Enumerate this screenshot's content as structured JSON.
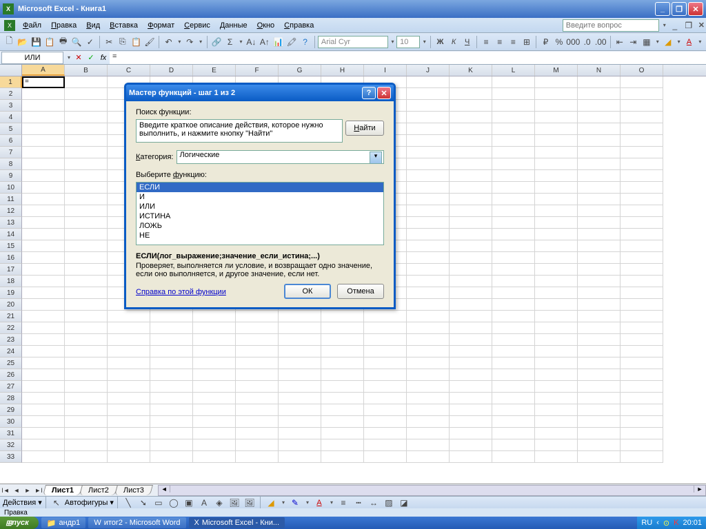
{
  "titlebar": {
    "app": "Microsoft Excel",
    "doc": "Книга1"
  },
  "menu": [
    "Файл",
    "Правка",
    "Вид",
    "Вставка",
    "Формат",
    "Сервис",
    "Данные",
    "Окно",
    "Справка"
  ],
  "questionPlaceholder": "Введите вопрос",
  "formatBar": {
    "font": "Arial Cyr",
    "size": "10"
  },
  "formula": {
    "nameBox": "ИЛИ",
    "value": "="
  },
  "columns": [
    "A",
    "B",
    "C",
    "D",
    "E",
    "F",
    "G",
    "H",
    "I",
    "J",
    "K",
    "L",
    "M",
    "N",
    "O"
  ],
  "rowCount": 33,
  "activeCell": {
    "row": 1,
    "col": "A",
    "value": "="
  },
  "sheets": {
    "active": "Лист1",
    "others": [
      "Лист2",
      "Лист3"
    ]
  },
  "drawBar": {
    "actions": "Действия",
    "autoshapes": "Автофигуры"
  },
  "status": "Правка",
  "taskbar": {
    "start": "пуск",
    "items": [
      "андр1",
      "итог2 - Microsoft Word",
      "Microsoft Excel - Кни..."
    ],
    "lang": "RU",
    "time": "20:01"
  },
  "dialog": {
    "title": "Мастер функций - шаг 1 из 2",
    "searchLabel": "Поиск функции:",
    "searchText": "Введите краткое описание действия, которое нужно выполнить, и нажмите кнопку \"Найти\"",
    "findBtn": "Найти",
    "categoryLabel": "Категория:",
    "category": "Логические",
    "selectLabel": "Выберите функцию:",
    "functions": [
      "ЕСЛИ",
      "И",
      "ИЛИ",
      "ИСТИНА",
      "ЛОЖЬ",
      "НЕ"
    ],
    "selectedFunction": "ЕСЛИ",
    "signature": "ЕСЛИ(лог_выражение;значение_если_истина;...)",
    "description": "Проверяет, выполняется ли условие, и возвращает одно значение, если оно выполняется, и другое значение, если нет.",
    "helpLink": "Справка по этой функции",
    "ok": "ОК",
    "cancel": "Отмена"
  }
}
